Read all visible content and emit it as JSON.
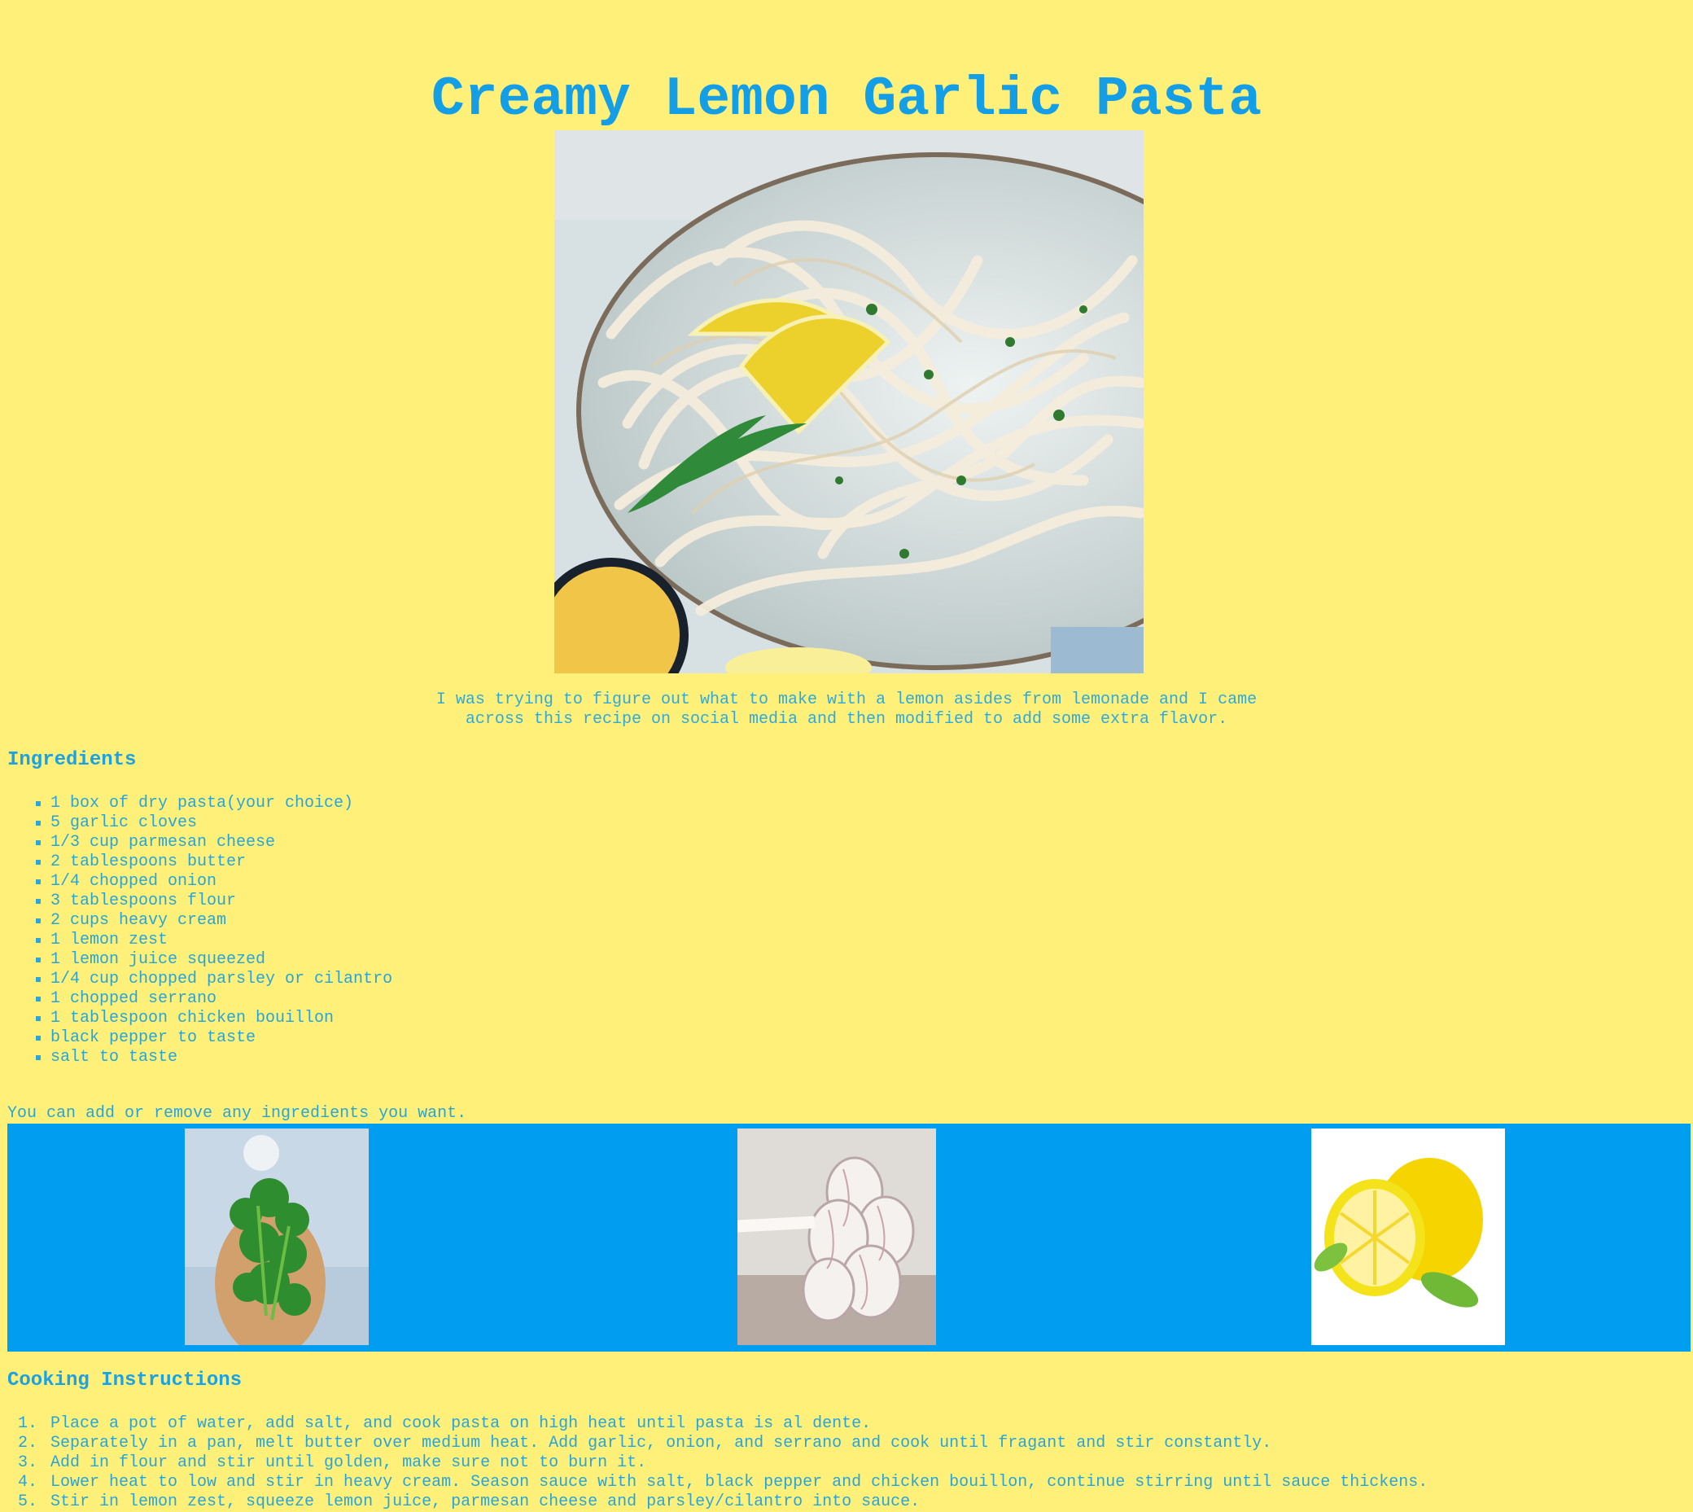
{
  "page": {
    "title": "Creamy Lemon Garlic Pasta",
    "intro": "I was trying to figure out what to make with a lemon asides from lemonade and I came across this recipe on social media and then modified to add some extra flavor."
  },
  "ingredients": {
    "heading": "Ingredients",
    "items": [
      "1 box of dry pasta(your choice)",
      "5 garlic cloves",
      "1/3 cup parmesan cheese",
      "2 tablespoons butter",
      "1/4 chopped onion",
      "3 tablespoons flour",
      "2 cups heavy cream",
      "1 lemon zest",
      "1 lemon juice squeezed",
      "1/4 cup chopped parsley or cilantro",
      "1 chopped serrano",
      "1 tablespoon chicken bouillon",
      "black pepper to taste",
      "salt to taste"
    ],
    "note": "You can add or remove any ingredients you want."
  },
  "instructions": {
    "heading": "Cooking Instructions",
    "numbers": [
      "1.",
      "2.",
      "3.",
      "4.",
      "5."
    ],
    "steps": [
      "Place a pot of water, add salt, and cook pasta on high heat until pasta is al dente.",
      "Separately in a pan, melt butter over medium heat. Add garlic, onion, and serrano and cook until fragant and stir constantly.",
      "Add in flour and stir until golden, make sure not to burn it.",
      "Lower heat to low and stir in heavy cream. Season sauce with salt, black pepper and chicken bouillon, continue stirring until sauce thickens.",
      "Stir in lemon zest, squeeze lemon juice, parmesan cheese and parsley/cilantro into sauce."
    ]
  },
  "colors": {
    "background": "#fff07a",
    "accent": "#149ee6",
    "gallery": "#009df0"
  },
  "icons": {
    "hero": "pasta-photo",
    "gallery": [
      "parsley-photo",
      "garlic-photo",
      "lemon-photo"
    ]
  }
}
